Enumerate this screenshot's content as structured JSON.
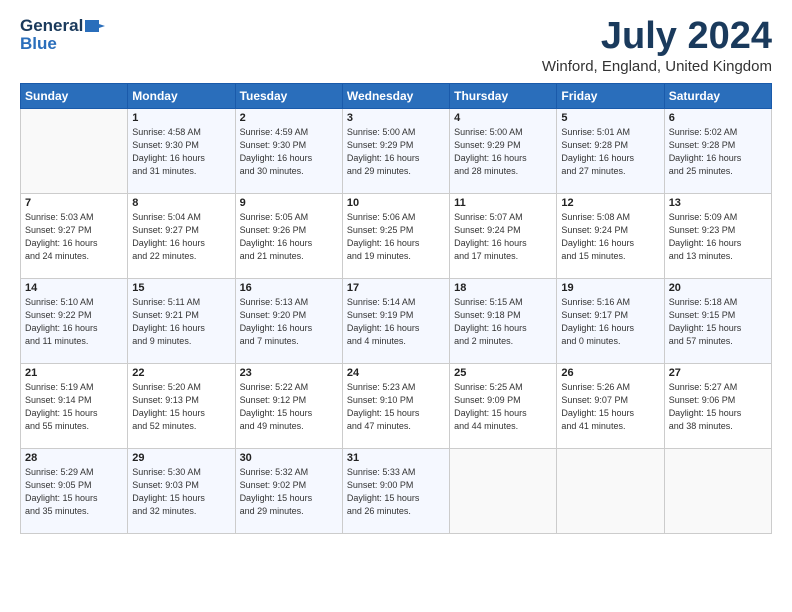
{
  "header": {
    "logo_line1": "General",
    "logo_line2": "Blue",
    "month": "July 2024",
    "location": "Winford, England, United Kingdom"
  },
  "weekdays": [
    "Sunday",
    "Monday",
    "Tuesday",
    "Wednesday",
    "Thursday",
    "Friday",
    "Saturday"
  ],
  "weeks": [
    [
      {
        "day": "",
        "info": ""
      },
      {
        "day": "1",
        "info": "Sunrise: 4:58 AM\nSunset: 9:30 PM\nDaylight: 16 hours\nand 31 minutes."
      },
      {
        "day": "2",
        "info": "Sunrise: 4:59 AM\nSunset: 9:30 PM\nDaylight: 16 hours\nand 30 minutes."
      },
      {
        "day": "3",
        "info": "Sunrise: 5:00 AM\nSunset: 9:29 PM\nDaylight: 16 hours\nand 29 minutes."
      },
      {
        "day": "4",
        "info": "Sunrise: 5:00 AM\nSunset: 9:29 PM\nDaylight: 16 hours\nand 28 minutes."
      },
      {
        "day": "5",
        "info": "Sunrise: 5:01 AM\nSunset: 9:28 PM\nDaylight: 16 hours\nand 27 minutes."
      },
      {
        "day": "6",
        "info": "Sunrise: 5:02 AM\nSunset: 9:28 PM\nDaylight: 16 hours\nand 25 minutes."
      }
    ],
    [
      {
        "day": "7",
        "info": "Sunrise: 5:03 AM\nSunset: 9:27 PM\nDaylight: 16 hours\nand 24 minutes."
      },
      {
        "day": "8",
        "info": "Sunrise: 5:04 AM\nSunset: 9:27 PM\nDaylight: 16 hours\nand 22 minutes."
      },
      {
        "day": "9",
        "info": "Sunrise: 5:05 AM\nSunset: 9:26 PM\nDaylight: 16 hours\nand 21 minutes."
      },
      {
        "day": "10",
        "info": "Sunrise: 5:06 AM\nSunset: 9:25 PM\nDaylight: 16 hours\nand 19 minutes."
      },
      {
        "day": "11",
        "info": "Sunrise: 5:07 AM\nSunset: 9:24 PM\nDaylight: 16 hours\nand 17 minutes."
      },
      {
        "day": "12",
        "info": "Sunrise: 5:08 AM\nSunset: 9:24 PM\nDaylight: 16 hours\nand 15 minutes."
      },
      {
        "day": "13",
        "info": "Sunrise: 5:09 AM\nSunset: 9:23 PM\nDaylight: 16 hours\nand 13 minutes."
      }
    ],
    [
      {
        "day": "14",
        "info": "Sunrise: 5:10 AM\nSunset: 9:22 PM\nDaylight: 16 hours\nand 11 minutes."
      },
      {
        "day": "15",
        "info": "Sunrise: 5:11 AM\nSunset: 9:21 PM\nDaylight: 16 hours\nand 9 minutes."
      },
      {
        "day": "16",
        "info": "Sunrise: 5:13 AM\nSunset: 9:20 PM\nDaylight: 16 hours\nand 7 minutes."
      },
      {
        "day": "17",
        "info": "Sunrise: 5:14 AM\nSunset: 9:19 PM\nDaylight: 16 hours\nand 4 minutes."
      },
      {
        "day": "18",
        "info": "Sunrise: 5:15 AM\nSunset: 9:18 PM\nDaylight: 16 hours\nand 2 minutes."
      },
      {
        "day": "19",
        "info": "Sunrise: 5:16 AM\nSunset: 9:17 PM\nDaylight: 16 hours\nand 0 minutes."
      },
      {
        "day": "20",
        "info": "Sunrise: 5:18 AM\nSunset: 9:15 PM\nDaylight: 15 hours\nand 57 minutes."
      }
    ],
    [
      {
        "day": "21",
        "info": "Sunrise: 5:19 AM\nSunset: 9:14 PM\nDaylight: 15 hours\nand 55 minutes."
      },
      {
        "day": "22",
        "info": "Sunrise: 5:20 AM\nSunset: 9:13 PM\nDaylight: 15 hours\nand 52 minutes."
      },
      {
        "day": "23",
        "info": "Sunrise: 5:22 AM\nSunset: 9:12 PM\nDaylight: 15 hours\nand 49 minutes."
      },
      {
        "day": "24",
        "info": "Sunrise: 5:23 AM\nSunset: 9:10 PM\nDaylight: 15 hours\nand 47 minutes."
      },
      {
        "day": "25",
        "info": "Sunrise: 5:25 AM\nSunset: 9:09 PM\nDaylight: 15 hours\nand 44 minutes."
      },
      {
        "day": "26",
        "info": "Sunrise: 5:26 AM\nSunset: 9:07 PM\nDaylight: 15 hours\nand 41 minutes."
      },
      {
        "day": "27",
        "info": "Sunrise: 5:27 AM\nSunset: 9:06 PM\nDaylight: 15 hours\nand 38 minutes."
      }
    ],
    [
      {
        "day": "28",
        "info": "Sunrise: 5:29 AM\nSunset: 9:05 PM\nDaylight: 15 hours\nand 35 minutes."
      },
      {
        "day": "29",
        "info": "Sunrise: 5:30 AM\nSunset: 9:03 PM\nDaylight: 15 hours\nand 32 minutes."
      },
      {
        "day": "30",
        "info": "Sunrise: 5:32 AM\nSunset: 9:02 PM\nDaylight: 15 hours\nand 29 minutes."
      },
      {
        "day": "31",
        "info": "Sunrise: 5:33 AM\nSunset: 9:00 PM\nDaylight: 15 hours\nand 26 minutes."
      },
      {
        "day": "",
        "info": ""
      },
      {
        "day": "",
        "info": ""
      },
      {
        "day": "",
        "info": ""
      }
    ]
  ]
}
